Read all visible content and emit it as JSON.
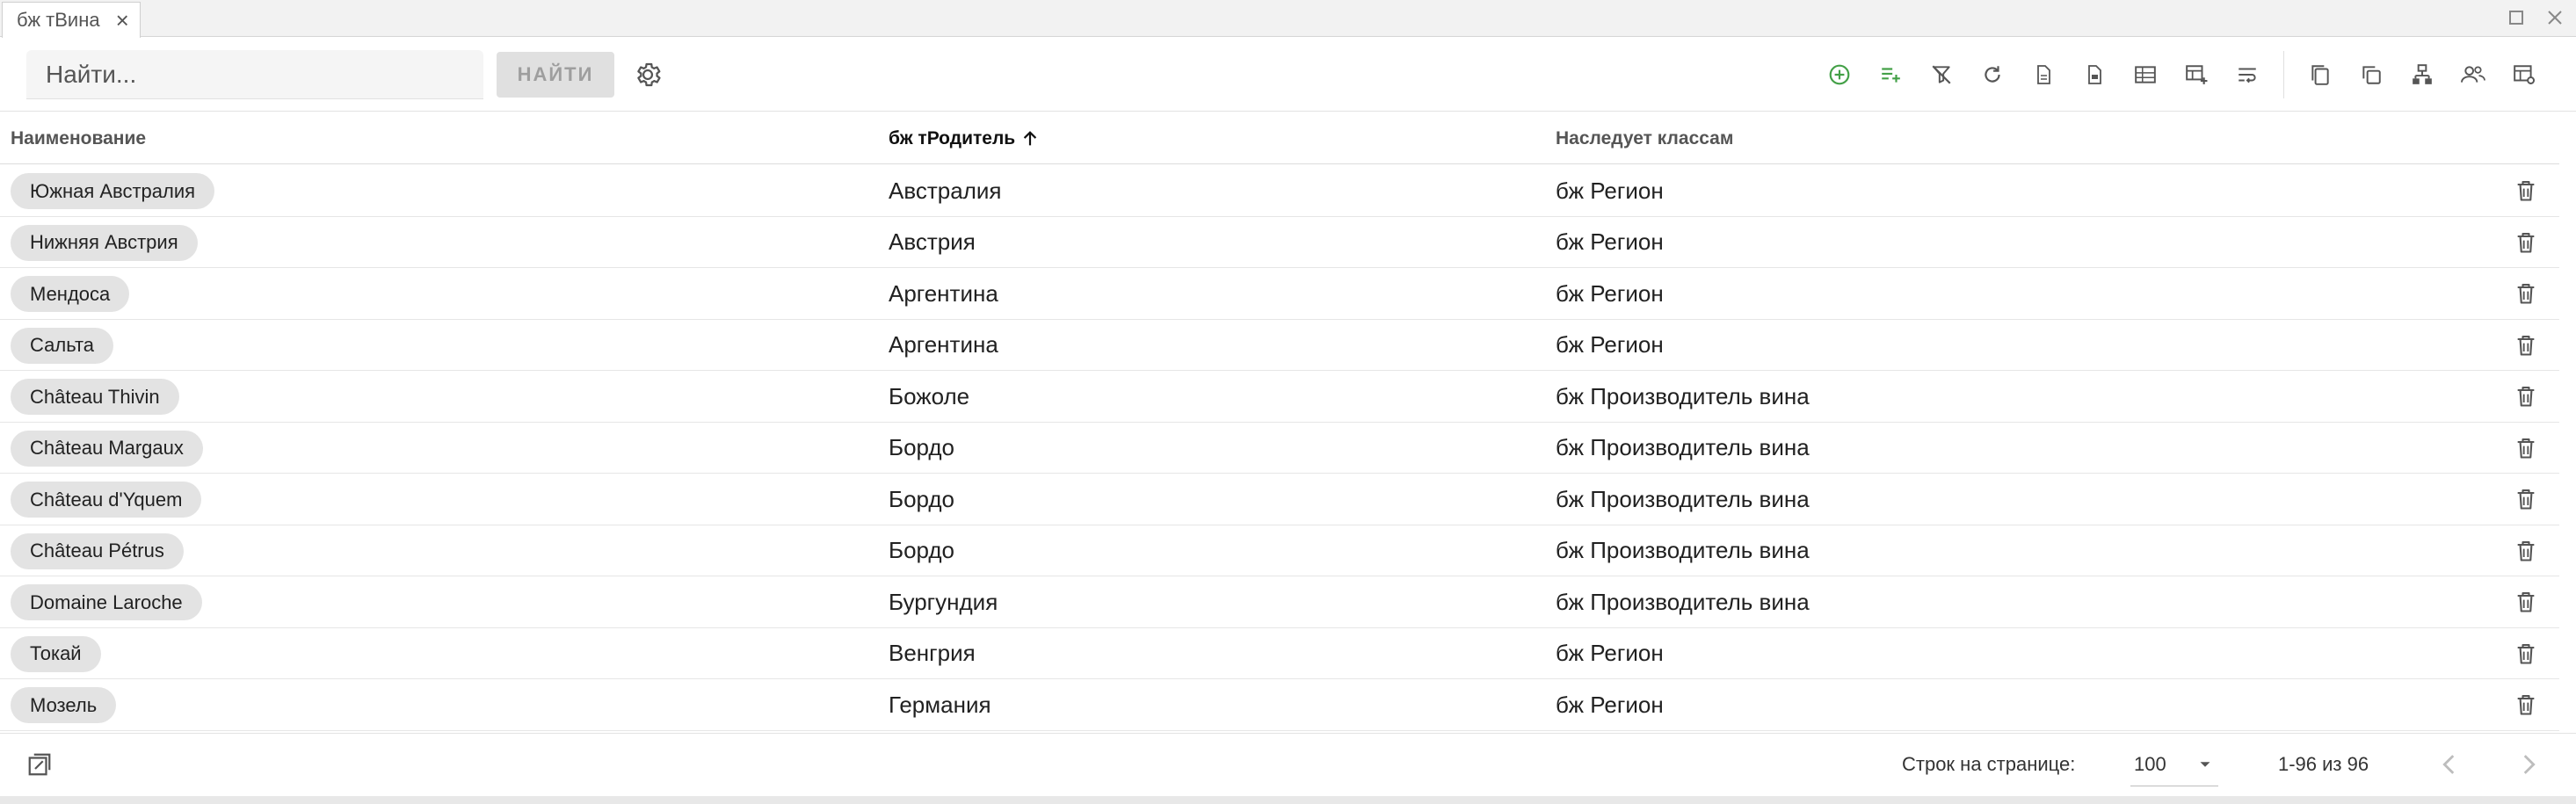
{
  "tab": {
    "label": "бж тВина"
  },
  "toolbar": {
    "search_placeholder": "Найти...",
    "find_label": "НАЙТИ",
    "icons": [
      "add-circle-icon",
      "add-list-icon",
      "clear-filter-icon",
      "refresh-icon",
      "export-doc-icon",
      "export-pdf-icon",
      "export-excel-icon",
      "add-column-icon",
      "wrap-text-icon",
      "copy-icon",
      "duplicate-icon",
      "hierarchy-icon",
      "users-icon",
      "table-settings-icon"
    ],
    "accent_green": "#43a047"
  },
  "table": {
    "columns": {
      "name": "Наименование",
      "parent": "бж тРодитель",
      "inherits": "Наследует классам"
    },
    "sort": {
      "column": "parent",
      "direction": "asc"
    },
    "rows": [
      {
        "name": "Южная Австралия",
        "parent": "Австралия",
        "inherits": "бж Регион"
      },
      {
        "name": "Нижняя Австрия",
        "parent": "Австрия",
        "inherits": "бж Регион"
      },
      {
        "name": "Мендоса",
        "parent": "Аргентина",
        "inherits": "бж Регион"
      },
      {
        "name": "Сальта",
        "parent": "Аргентина",
        "inherits": "бж Регион"
      },
      {
        "name": "Château Thivin",
        "parent": "Божоле",
        "inherits": "бж Производитель вина"
      },
      {
        "name": "Château Margaux",
        "parent": "Бордо",
        "inherits": "бж Производитель вина"
      },
      {
        "name": "Château d'Yquem",
        "parent": "Бордо",
        "inherits": "бж Производитель вина"
      },
      {
        "name": "Château Pétrus",
        "parent": "Бордо",
        "inherits": "бж Производитель вина"
      },
      {
        "name": "Domaine Laroche",
        "parent": "Бургундия",
        "inherits": "бж Производитель вина"
      },
      {
        "name": "Токай",
        "parent": "Венгрия",
        "inherits": "бж Регион"
      },
      {
        "name": "Мозель",
        "parent": "Германия",
        "inherits": "бж Регион"
      }
    ]
  },
  "footer": {
    "rows_per_page_label": "Строк на странице:",
    "rows_per_page": "100",
    "range": "1-96 из 96"
  }
}
